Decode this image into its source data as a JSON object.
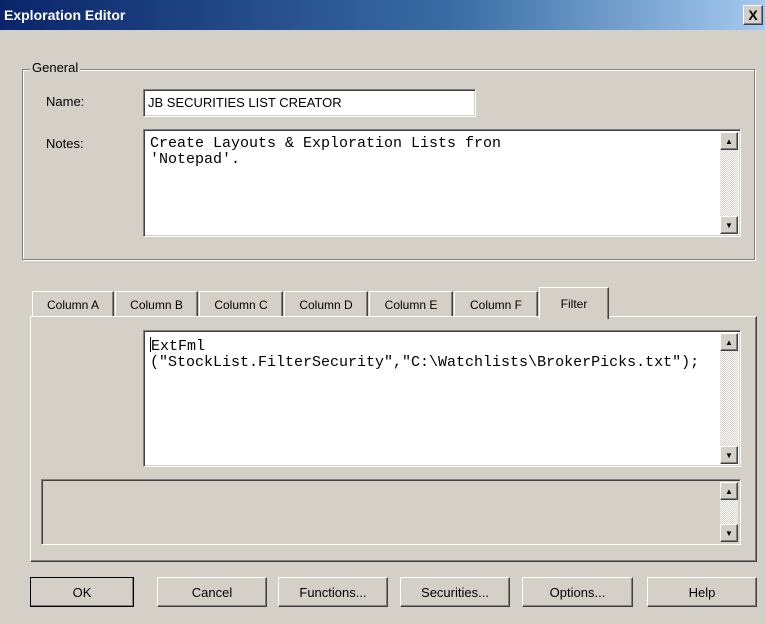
{
  "window": {
    "title": "Exploration Editor",
    "close_glyph": "X"
  },
  "general": {
    "legend": "General",
    "name_label": "Name:",
    "name_value": "JB SECURITIES LIST CREATOR",
    "notes_label": "Notes:",
    "notes_value": "Create Layouts & Exploration Lists fron\n'Notepad'."
  },
  "tabs": [
    {
      "label": "Column A",
      "active": false
    },
    {
      "label": "Column B",
      "active": false
    },
    {
      "label": "Column C",
      "active": false
    },
    {
      "label": "Column D",
      "active": false
    },
    {
      "label": "Column E",
      "active": false
    },
    {
      "label": "Column F",
      "active": false
    },
    {
      "label": "Filter",
      "active": true
    }
  ],
  "filter": {
    "formula": "ExtFml\n(\"StockList.FilterSecurity\",\"C:\\Watchlists\\BrokerPicks.txt\");",
    "message": ""
  },
  "buttons": {
    "ok": "OK",
    "cancel": "Cancel",
    "functions": "Functions...",
    "securities": "Securities...",
    "options": "Options...",
    "help": "Help"
  },
  "icons": {
    "scroll_up": "scroll-up-arrow-icon",
    "scroll_down": "scroll-down-arrow-icon",
    "close": "close-icon"
  }
}
